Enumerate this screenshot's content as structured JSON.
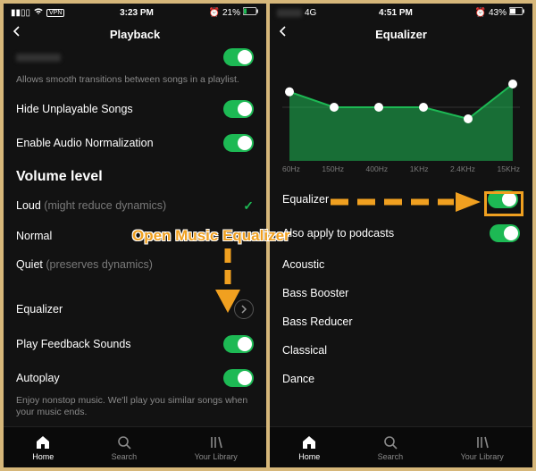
{
  "callout_text": "Open Music Equalizer",
  "left": {
    "status": {
      "vpn": "VPN",
      "time": "3:23 PM",
      "battery": "21%"
    },
    "title": "Playback",
    "automix_desc": "Allows smooth transitions between songs in a playlist.",
    "rows": {
      "hide_unplayable": "Hide Unplayable Songs",
      "normalize": "Enable Audio Normalization"
    },
    "volume_section": "Volume level",
    "volume": {
      "loud": "Loud",
      "loud_hint": "(might reduce dynamics)",
      "normal": "Normal",
      "quiet": "Quiet",
      "quiet_hint": "(preserves dynamics)"
    },
    "equalizer": "Equalizer",
    "feedback": "Play Feedback Sounds",
    "autoplay": "Autoplay",
    "autoplay_desc": "Enjoy nonstop music. We'll play you similar songs when your music ends.",
    "nav": {
      "home": "Home",
      "search": "Search",
      "library": "Your Library"
    }
  },
  "right": {
    "status": {
      "net": "4G",
      "time": "4:51 PM",
      "battery": "43%"
    },
    "title": "Equalizer",
    "eq_bands": [
      "60Hz",
      "150Hz",
      "400Hz",
      "1KHz",
      "2.4KHz",
      "15KHz"
    ],
    "eq_row": "Equalizer",
    "podcasts": "Also apply to podcasts",
    "presets": [
      "Acoustic",
      "Bass Booster",
      "Bass Reducer",
      "Classical",
      "Dance"
    ],
    "nav": {
      "home": "Home",
      "search": "Search",
      "library": "Your Library"
    }
  },
  "chart_data": {
    "type": "line",
    "categories": [
      "60Hz",
      "150Hz",
      "400Hz",
      "1KHz",
      "2.4KHz",
      "15KHz"
    ],
    "values": [
      2,
      0,
      0,
      0,
      -1.5,
      3
    ],
    "ylim": [
      -6,
      6
    ],
    "xlabel": "",
    "ylabel": "",
    "title": ""
  }
}
